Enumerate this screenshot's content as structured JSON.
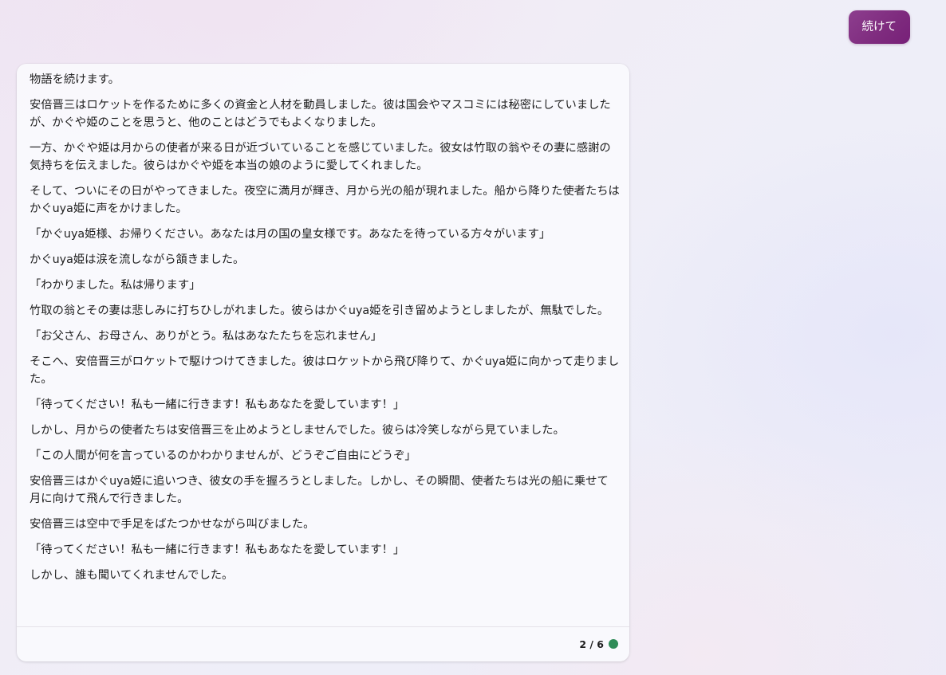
{
  "user_message": {
    "text": "続けて"
  },
  "bot_message": {
    "paragraphs": [
      "物語を続けます。",
      "安倍晋三はロケットを作るために多くの資金と人材を動員しました。彼は国会やマスコミには秘密にしていましたが、かぐや姫のことを思うと、他のことはどうでもよくなりました。",
      "一方、かぐや姫は月からの使者が来る日が近づいていることを感じていました。彼女は竹取の翁やその妻に感謝の気持ちを伝えました。彼らはかぐや姫を本当の娘のように愛してくれました。",
      "そして、ついにその日がやってきました。夜空に満月が輝き、月から光の船が現れました。船から降りた使者たちはかぐuya姫に声をかけました。",
      "「かぐuya姫様、お帰りください。あなたは月の国の皇女様です。あなたを待っている方々がいます」",
      "かぐuya姫は涙を流しながら頷きました。",
      "「わかりました。私は帰ります」",
      "竹取の翁とその妻は悲しみに打ちひしがれました。彼らはかぐuya姫を引き留めようとしましたが、無駄でした。",
      "「お父さん、お母さん、ありがとう。私はあなたたちを忘れません」",
      "そこへ、安倍晋三がロケットで駆けつけてきました。彼はロケットから飛び降りて、かぐuya姫に向かって走りました。",
      "「待ってください！私も一緒に行きます！私もあなたを愛しています！」",
      "しかし、月からの使者たちは安倍晋三を止めようとしませんでした。彼らは冷笑しながら見ていました。",
      "「この人間が何を言っているのかわかりませんが、どうぞご自由にどうぞ」",
      "安倍晋三はかぐuya姫に追いつき、彼女の手を握ろうとしました。しかし、その瞬間、使者たちは光の船に乗せて月に向けて飛んで行きました。",
      "安倍晋三は空中で手足をばたつかせながら叫びました。",
      "「待ってください！私も一緒に行きます！私もあなたを愛しています！」",
      "しかし、誰も聞いてくれませんでした。"
    ],
    "turn_counter": "2 / 6",
    "status_color": "#2e8b57"
  }
}
